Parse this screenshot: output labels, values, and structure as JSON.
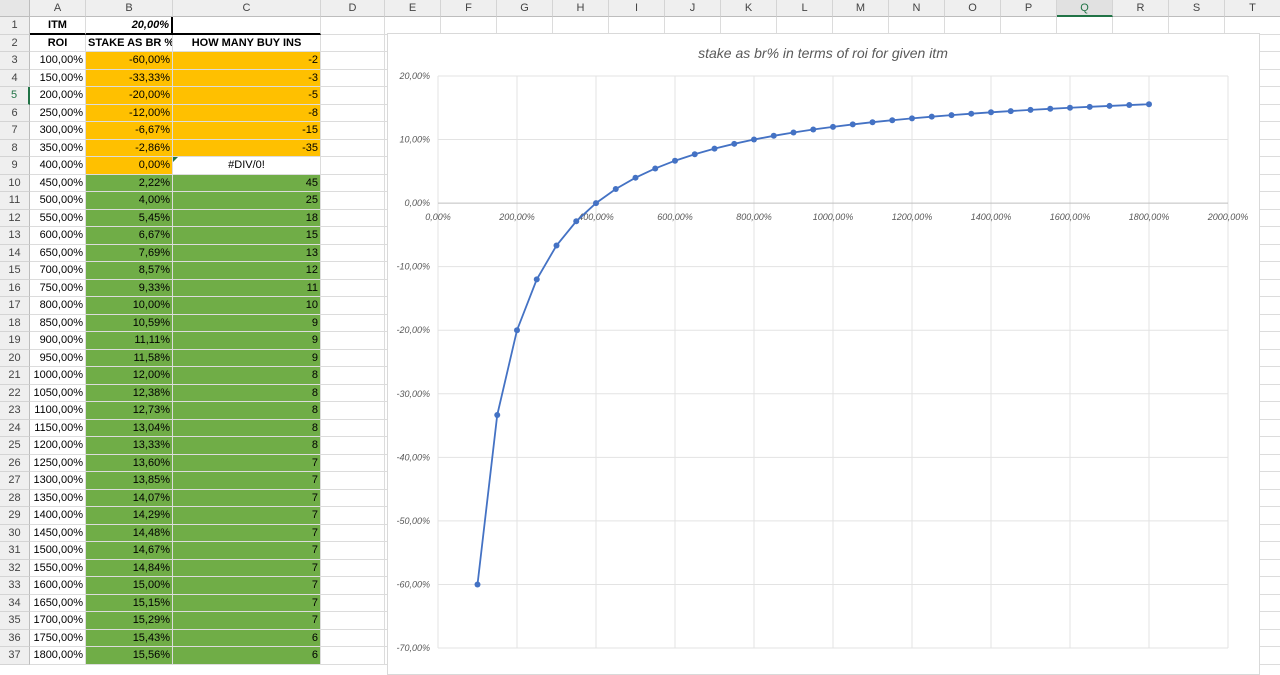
{
  "columns": [
    "A",
    "B",
    "C",
    "D",
    "E",
    "F",
    "G",
    "H",
    "I",
    "J",
    "K",
    "L",
    "M",
    "N",
    "O",
    "P",
    "Q",
    "R",
    "S",
    "T"
  ],
  "selected_column": "Q",
  "selected_row": 5,
  "header_row": {
    "itm_label": "ITM",
    "itm_value": "20,00%"
  },
  "table_headers": [
    "ROI",
    "STAKE AS BR %",
    "HOW MANY BUY INS"
  ],
  "rows": [
    [
      "100,00%",
      "-60,00%",
      "-2"
    ],
    [
      "150,00%",
      "-33,33%",
      "-3"
    ],
    [
      "200,00%",
      "-20,00%",
      "-5"
    ],
    [
      "250,00%",
      "-12,00%",
      "-8"
    ],
    [
      "300,00%",
      "-6,67%",
      "-15"
    ],
    [
      "350,00%",
      "-2,86%",
      "-35"
    ],
    [
      "400,00%",
      "0,00%",
      "#DIV/0!"
    ],
    [
      "450,00%",
      "2,22%",
      "45"
    ],
    [
      "500,00%",
      "4,00%",
      "25"
    ],
    [
      "550,00%",
      "5,45%",
      "18"
    ],
    [
      "600,00%",
      "6,67%",
      "15"
    ],
    [
      "650,00%",
      "7,69%",
      "13"
    ],
    [
      "700,00%",
      "8,57%",
      "12"
    ],
    [
      "750,00%",
      "9,33%",
      "11"
    ],
    [
      "800,00%",
      "10,00%",
      "10"
    ],
    [
      "850,00%",
      "10,59%",
      "9"
    ],
    [
      "900,00%",
      "11,11%",
      "9"
    ],
    [
      "950,00%",
      "11,58%",
      "9"
    ],
    [
      "1000,00%",
      "12,00%",
      "8"
    ],
    [
      "1050,00%",
      "12,38%",
      "8"
    ],
    [
      "1100,00%",
      "12,73%",
      "8"
    ],
    [
      "1150,00%",
      "13,04%",
      "8"
    ],
    [
      "1200,00%",
      "13,33%",
      "8"
    ],
    [
      "1250,00%",
      "13,60%",
      "7"
    ],
    [
      "1300,00%",
      "13,85%",
      "7"
    ],
    [
      "1350,00%",
      "14,07%",
      "7"
    ],
    [
      "1400,00%",
      "14,29%",
      "7"
    ],
    [
      "1450,00%",
      "14,48%",
      "7"
    ],
    [
      "1500,00%",
      "14,67%",
      "7"
    ],
    [
      "1550,00%",
      "14,84%",
      "7"
    ],
    [
      "1600,00%",
      "15,00%",
      "7"
    ],
    [
      "1650,00%",
      "15,15%",
      "7"
    ],
    [
      "1700,00%",
      "15,29%",
      "7"
    ],
    [
      "1750,00%",
      "15,43%",
      "6"
    ],
    [
      "1800,00%",
      "15,56%",
      "6"
    ]
  ],
  "colors": {
    "negative_fill": "#FFC000",
    "positive_fill": "#70AD47",
    "line": "#4472C4"
  },
  "chart_data": {
    "type": "line",
    "title": "stake as br% in terms of roi for given itm",
    "xlim": [
      0,
      2000
    ],
    "ylim": [
      -70,
      20
    ],
    "x_ticks": [
      "0,00%",
      "200,00%",
      "400,00%",
      "600,00%",
      "800,00%",
      "1000,00%",
      "1200,00%",
      "1400,00%",
      "1600,00%",
      "1800,00%",
      "2000,00%"
    ],
    "y_ticks": [
      "20,00%",
      "10,00%",
      "0,00%",
      "-10,00%",
      "-20,00%",
      "-30,00%",
      "-40,00%",
      "-50,00%",
      "-60,00%",
      "-70,00%"
    ],
    "x": [
      100,
      150,
      200,
      250,
      300,
      350,
      400,
      450,
      500,
      550,
      600,
      650,
      700,
      750,
      800,
      850,
      900,
      950,
      1000,
      1050,
      1100,
      1150,
      1200,
      1250,
      1300,
      1350,
      1400,
      1450,
      1500,
      1550,
      1600,
      1650,
      1700,
      1750,
      1800
    ],
    "y": [
      -60,
      -33.33,
      -20,
      -12,
      -6.67,
      -2.86,
      0,
      2.22,
      4,
      5.45,
      6.67,
      7.69,
      8.57,
      9.33,
      10,
      10.59,
      11.11,
      11.58,
      12,
      12.38,
      12.73,
      13.04,
      13.33,
      13.6,
      13.85,
      14.07,
      14.29,
      14.48,
      14.67,
      14.84,
      15,
      15.15,
      15.29,
      15.43,
      15.56
    ]
  }
}
